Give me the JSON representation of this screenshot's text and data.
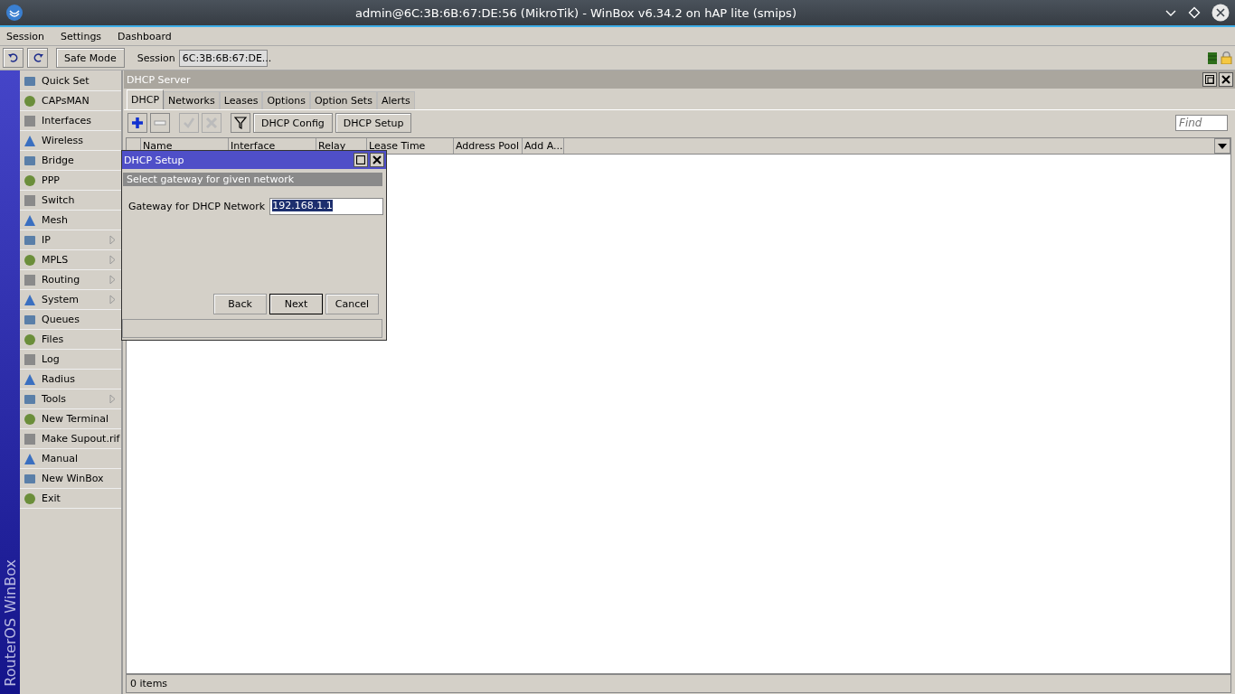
{
  "window": {
    "title": "admin@6C:3B:6B:67:DE:56 (MikroTik) - WinBox v6.34.2 on hAP lite (smips)"
  },
  "menu": [
    "Session",
    "Settings",
    "Dashboard"
  ],
  "toolbar": {
    "safe_mode": "Safe Mode",
    "session_label": "Session",
    "session_value": "6C:3B:6B:67:DE..."
  },
  "side_banner": "RouterOS WinBox",
  "sidebar": {
    "items": [
      {
        "label": "Quick Set",
        "has_submenu": false
      },
      {
        "label": "CAPsMAN",
        "has_submenu": false
      },
      {
        "label": "Interfaces",
        "has_submenu": false
      },
      {
        "label": "Wireless",
        "has_submenu": false
      },
      {
        "label": "Bridge",
        "has_submenu": false
      },
      {
        "label": "PPP",
        "has_submenu": false
      },
      {
        "label": "Switch",
        "has_submenu": false
      },
      {
        "label": "Mesh",
        "has_submenu": false
      },
      {
        "label": "IP",
        "has_submenu": true
      },
      {
        "label": "MPLS",
        "has_submenu": true
      },
      {
        "label": "Routing",
        "has_submenu": true
      },
      {
        "label": "System",
        "has_submenu": true
      },
      {
        "label": "Queues",
        "has_submenu": false
      },
      {
        "label": "Files",
        "has_submenu": false
      },
      {
        "label": "Log",
        "has_submenu": false
      },
      {
        "label": "Radius",
        "has_submenu": false
      },
      {
        "label": "Tools",
        "has_submenu": true
      },
      {
        "label": "New Terminal",
        "has_submenu": false
      },
      {
        "label": "Make Supout.rif",
        "has_submenu": false
      },
      {
        "label": "Manual",
        "has_submenu": false
      },
      {
        "label": "New WinBox",
        "has_submenu": false
      },
      {
        "label": "Exit",
        "has_submenu": false
      }
    ]
  },
  "dhcp_window": {
    "title": "DHCP Server",
    "tabs": [
      {
        "label": "DHCP",
        "selected": true
      },
      {
        "label": "Networks",
        "selected": false
      },
      {
        "label": "Leases",
        "selected": false
      },
      {
        "label": "Options",
        "selected": false
      },
      {
        "label": "Option Sets",
        "selected": false
      },
      {
        "label": "Alerts",
        "selected": false
      }
    ],
    "tool_buttons": [
      {
        "kind": "add",
        "disabled": false
      },
      {
        "kind": "remove",
        "disabled": false
      },
      {
        "kind": "enable",
        "disabled": true
      },
      {
        "kind": "disable",
        "disabled": true
      },
      {
        "kind": "filter",
        "disabled": false
      }
    ],
    "buttons": [
      "DHCP Config",
      "DHCP Setup"
    ],
    "find_placeholder": "Find",
    "table": {
      "columns": [
        "Name",
        "Interface",
        "Relay",
        "Lease Time",
        "Address Pool",
        "Add A..."
      ]
    },
    "status_bar": "0 items"
  },
  "dialog": {
    "title": "DHCP Setup",
    "step": "Select gateway for given network",
    "field_label": "Gateway for DHCP Network",
    "field_value": "192.168.1.1",
    "buttons": [
      {
        "label": "Back",
        "default": false
      },
      {
        "label": "Next",
        "default": true
      },
      {
        "label": "Cancel",
        "default": false
      }
    ]
  }
}
